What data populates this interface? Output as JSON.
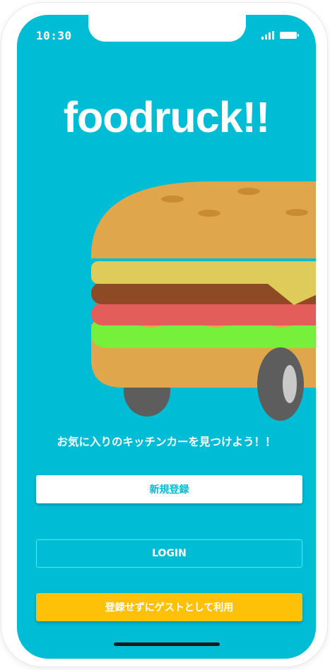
{
  "status_bar": {
    "time": "10:30",
    "icons": [
      "signal-icon",
      "battery-icon"
    ]
  },
  "app": {
    "title": "foodruck!!",
    "illustration": "burger-truck-illustration",
    "tagline": "お気に入りのキッチンカーを見つけよう！！"
  },
  "buttons": {
    "register_label": "新規登録",
    "login_label": "LOGIN",
    "guest_label": "登録せずにゲストとして利用"
  },
  "colors": {
    "background": "#00bcd4",
    "register_button_bg": "#ffffff",
    "register_button_text": "#00bcd4",
    "guest_button_bg": "#ffc107",
    "bun": "#e0a64c",
    "cheese": "#dfcb5a",
    "patty": "#8e4a24",
    "tomato": "#e35e5a",
    "lettuce": "#76f03a",
    "wheel": "#5d5d5d"
  }
}
